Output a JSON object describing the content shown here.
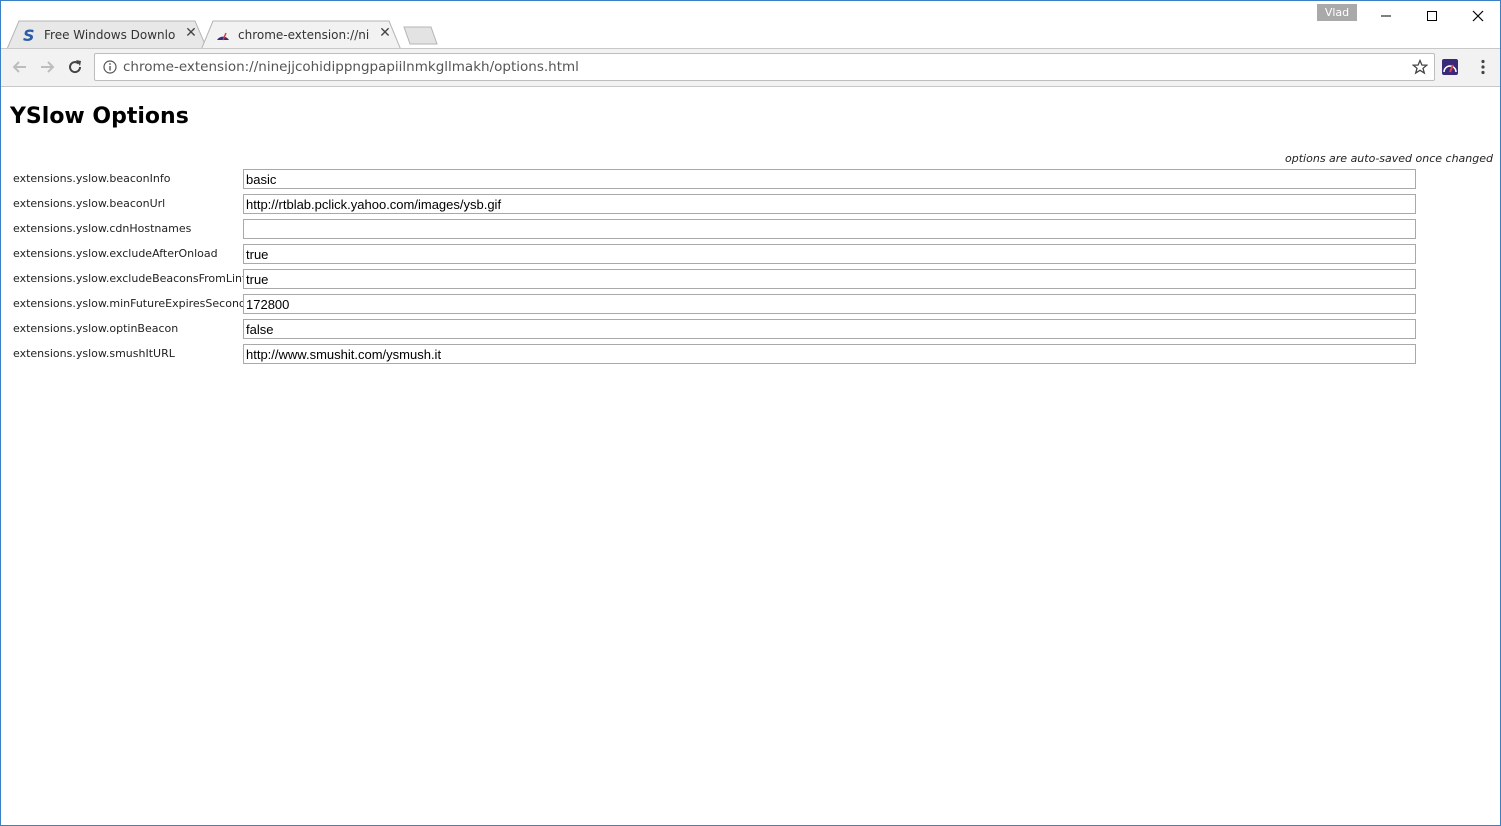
{
  "browser": {
    "tabs": [
      {
        "title": "Free Windows Downloads",
        "icon": "softpedia-s-icon"
      },
      {
        "title": "chrome-extension://ninejjcohidippngpapiilnmkgllmakh/options.html",
        "icon": "yslow-icon"
      }
    ],
    "profile_name": "Vlad",
    "url": "chrome-extension://ninejjcohidippngpapiilnmkgllmakh/options.html"
  },
  "page": {
    "title": "YSlow Options",
    "autosave_note": "options are auto-saved once changed",
    "options": [
      {
        "label": "extensions.yslow.beaconInfo",
        "value": "basic"
      },
      {
        "label": "extensions.yslow.beaconUrl",
        "value": "http://rtblab.pclick.yahoo.com/images/ysb.gif"
      },
      {
        "label": "extensions.yslow.cdnHostnames",
        "value": ""
      },
      {
        "label": "extensions.yslow.excludeAfterOnload",
        "value": "true"
      },
      {
        "label": "extensions.yslow.excludeBeaconsFromLint",
        "value": "true"
      },
      {
        "label": "extensions.yslow.minFutureExpiresSeconds",
        "value": "172800"
      },
      {
        "label": "extensions.yslow.optinBeacon",
        "value": "false"
      },
      {
        "label": "extensions.yslow.smushItURL",
        "value": "http://www.smushit.com/ysmush.it"
      }
    ]
  },
  "colors": {
    "window_border": "#3b7fc4",
    "toolbar_bg": "#f2f2f2",
    "profile_badge": "#a9a9a9"
  }
}
